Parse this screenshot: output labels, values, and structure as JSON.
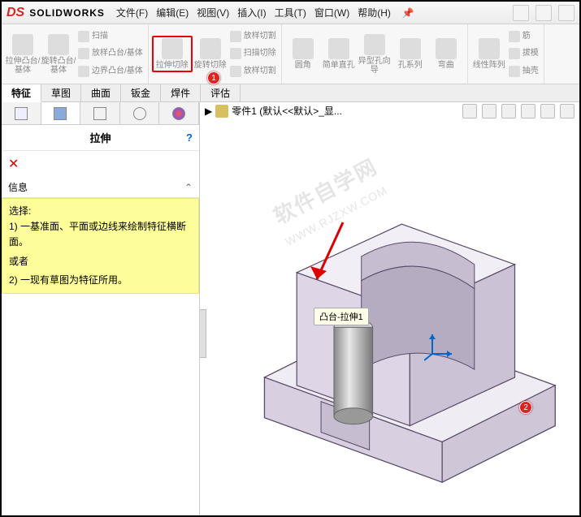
{
  "brand": {
    "logo": "DS",
    "name": "SOLIDWORKS"
  },
  "menu": [
    "文件(F)",
    "编辑(E)",
    "视图(V)",
    "插入(I)",
    "工具(T)",
    "窗口(W)",
    "帮助(H)"
  ],
  "ribbon": {
    "r1a": "拉伸凸台/基体",
    "r1b": "旋转凸台/基体",
    "r1c1": "扫描",
    "r1c2": "放样凸台/基体",
    "r1c3": "边界凸台/基体",
    "r2a": "拉伸切除",
    "r2b": "旋转切除",
    "r2c1": "放样切割",
    "r2c2": "扫描切除",
    "r2c3": "放样切割",
    "r3a": "圆角",
    "r3b": "简单直孔",
    "r3c": "异型孔向导",
    "r3d": "孔系列",
    "r3e": "弯曲",
    "r4a": "线性阵列",
    "r4b": "筋",
    "r4c": "拔模",
    "r4d": "抽壳"
  },
  "tabs": [
    "特征",
    "草图",
    "曲面",
    "钣金",
    "焊件",
    "评估"
  ],
  "active_tab": 0,
  "panel": {
    "title": "拉伸",
    "section": "信息",
    "info_label": "选择:",
    "info_line1": "1) 一基准面、平面或边线来绘制特征横断面。",
    "info_or": "或者",
    "info_line2": "2) 一现有草图为特征所用。"
  },
  "breadcrumb": {
    "arrow": "▶",
    "part": "零件1  (默认<<默认>_显..."
  },
  "tooltip": "凸台-拉伸1",
  "watermark": {
    "l1": "软件自学网",
    "l2": "WWW.RJZXW.COM"
  },
  "markers": {
    "m1": "1",
    "m2": "2"
  },
  "help_glyph": "?",
  "close_glyph": "✕",
  "chev_glyph": "⌃"
}
